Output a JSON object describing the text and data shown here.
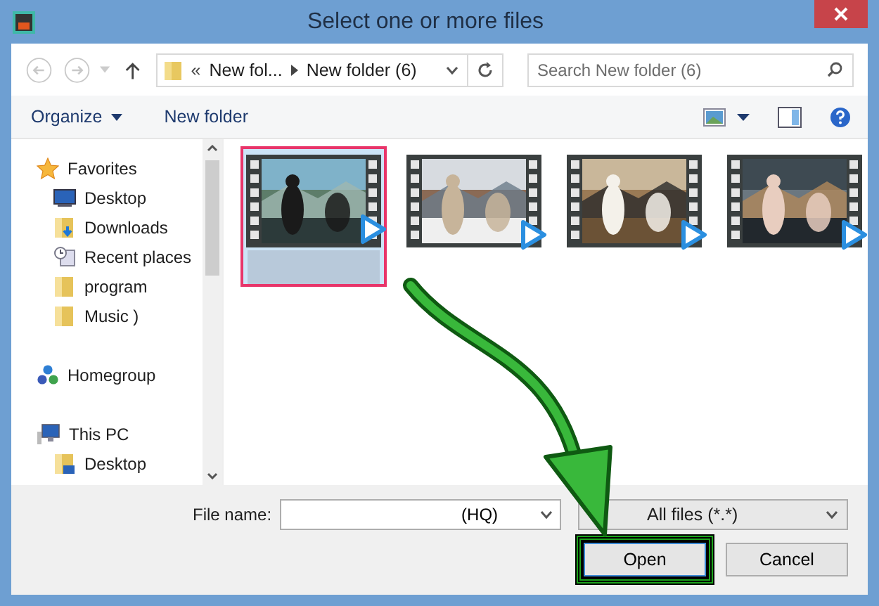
{
  "window": {
    "title": "Select one or more files"
  },
  "nav": {
    "overflow": "«",
    "breadcrumb": [
      "New fol...",
      "New folder (6)"
    ],
    "search": {
      "placeholder": "Search New folder (6)"
    }
  },
  "toolbar": {
    "buttons": [
      {
        "label": "Organize",
        "dropdown": true
      },
      {
        "label": "New folder",
        "dropdown": false
      }
    ]
  },
  "sidebar": {
    "groups": [
      {
        "label": "Favorites",
        "kind": "favorites",
        "children": [
          {
            "label": "Desktop",
            "kind": "desktop"
          },
          {
            "label": "Downloads",
            "kind": "downloads"
          },
          {
            "label": "Recent places",
            "kind": "recent"
          },
          {
            "label": "program",
            "kind": "folder"
          },
          {
            "label": "Music )",
            "kind": "folder"
          }
        ]
      },
      {
        "label": "Homegroup",
        "kind": "homegroup"
      },
      {
        "label": "This PC",
        "kind": "computer",
        "children": [
          {
            "label": "Desktop",
            "kind": "desktopfolder"
          }
        ]
      }
    ]
  },
  "files": [
    {
      "kind": "video",
      "selected": true
    },
    {
      "kind": "video",
      "selected": false
    },
    {
      "kind": "video",
      "selected": false
    },
    {
      "kind": "video",
      "selected": false
    }
  ],
  "bottom": {
    "file_name_label": "File name:",
    "file_name": {
      "value": "(HQ)"
    },
    "file_type": "All files (*.*)",
    "buttons": [
      {
        "label": "Open",
        "highlighted": true
      },
      {
        "label": "Cancel",
        "highlighted": false
      }
    ]
  },
  "annotation": {
    "kind": "arrow"
  }
}
